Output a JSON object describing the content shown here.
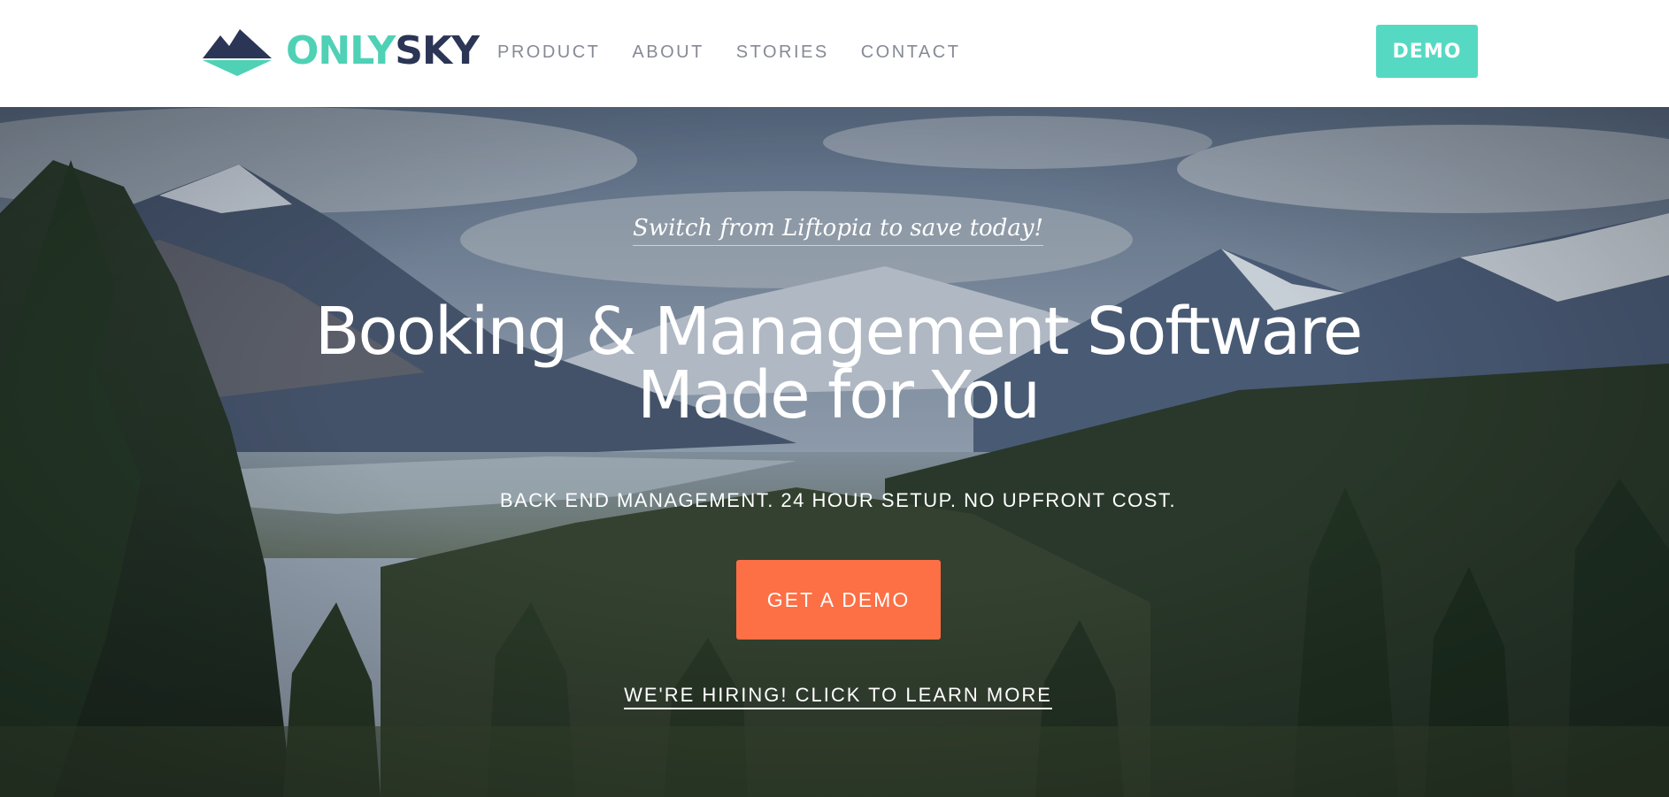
{
  "brand": {
    "name_part1": "ONLY",
    "name_part2": "SKY",
    "logo_icon": "mountain-logo-icon",
    "colors": {
      "teal": "#4fd1b5",
      "navy": "#2b3555"
    }
  },
  "nav": {
    "items": [
      {
        "label": "PRODUCT"
      },
      {
        "label": "ABOUT"
      },
      {
        "label": "STORIES"
      },
      {
        "label": "CONTACT"
      }
    ]
  },
  "header": {
    "demo_label": "DEMO",
    "demo_color": "#56d9c3"
  },
  "hero": {
    "tagline": "Switch from Liftopia to save today!",
    "headline_line1": "Booking & Management Software",
    "headline_line2": "Made for You",
    "subhead": "BACK END MANAGEMENT. 24 HOUR SETUP. NO UPFRONT COST.",
    "cta_label": "GET A DEMO",
    "cta_color": "#fd6f45",
    "hiring_link": "WE'RE HIRING! CLICK TO LEARN MORE",
    "background": "mountain-landscape-image"
  }
}
